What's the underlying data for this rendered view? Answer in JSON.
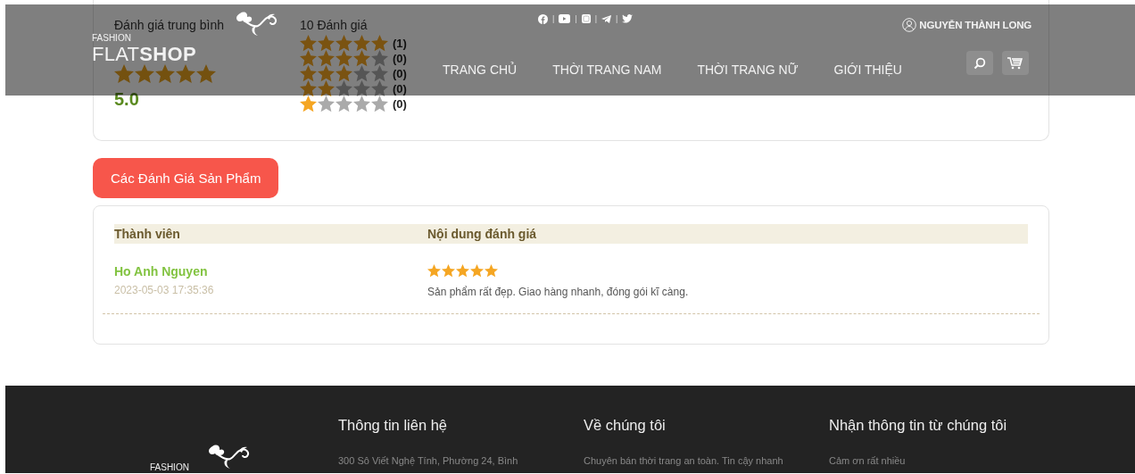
{
  "header": {
    "logo": {
      "small": "FASHION",
      "light": "FLAT",
      "bold": "SHOP"
    },
    "socials": [
      {
        "kind": "facebook"
      },
      {
        "kind": "youtube"
      },
      {
        "kind": "instagram"
      },
      {
        "kind": "telegram"
      },
      {
        "kind": "twitter"
      }
    ],
    "social_separator": "|",
    "user": "NGUYỄN THÀNH LONG",
    "nav": [
      {
        "label": "TRANG CHỦ"
      },
      {
        "label": "THỜI TRANG NAM"
      },
      {
        "label": "THỜI TRANG NỮ"
      },
      {
        "label": "GIỚI THIỆU"
      }
    ]
  },
  "rating_summary": {
    "average": {
      "label": "Đánh giá trung bình",
      "stars": 5,
      "value": "5.0"
    },
    "total": "10 Đánh giá",
    "distribution": [
      {
        "stars": 5,
        "count": "(1)"
      },
      {
        "stars": 4,
        "count": "(0)"
      },
      {
        "stars": 3,
        "count": "(0)"
      },
      {
        "stars": 2,
        "count": "(0)"
      },
      {
        "stars": 1,
        "count": "(0)"
      }
    ]
  },
  "reviews_tab": "Các Đánh Giá Sản Phẩm",
  "reviews": {
    "columns": [
      "Thành viên",
      "Nội dung đánh giá"
    ],
    "rows": [
      {
        "member": "Ho Anh Nguyen",
        "date": "2023-05-03 17:35:36",
        "stars": 5,
        "comment": "Sản phẩm rất đẹp. Giao hàng nhanh, đóng gói kĩ càng."
      }
    ]
  },
  "footer": {
    "logo_small": "FASHION",
    "columns": [
      {
        "title": "Thông tin liên hệ",
        "text": "300 Sô Viết Nghệ Tính, Phường 24, Bình"
      },
      {
        "title": "Về chúng tôi",
        "text": "Chuyên bán thời trang an toàn. Tin cậy nhanh"
      },
      {
        "title": "Nhận thông tin từ chúng tôi",
        "text": "Cảm ơn rất nhiều"
      }
    ]
  }
}
